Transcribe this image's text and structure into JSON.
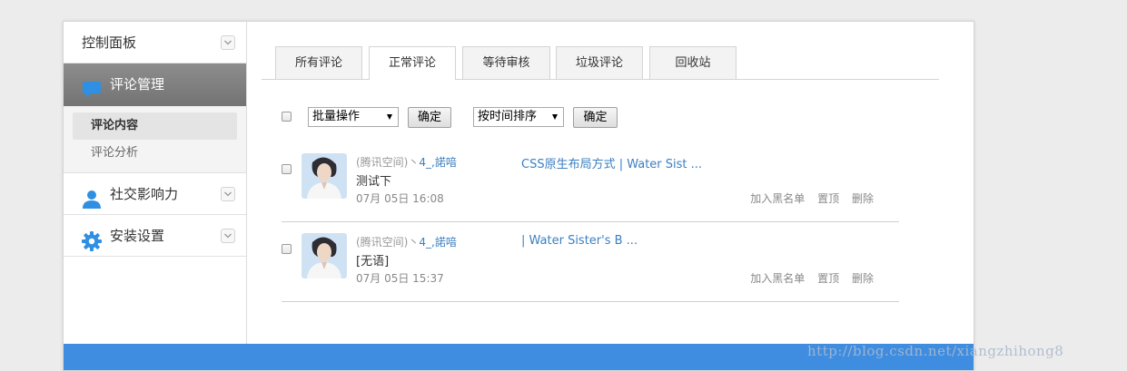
{
  "sidebar": {
    "dashboard": "控制面板",
    "comments_manage": "评论管理",
    "sub": [
      "评论内容",
      "评论分析"
    ],
    "social": "社交影响力",
    "install": "安装设置"
  },
  "tabs": [
    "所有评论",
    "正常评论",
    "等待审核",
    "垃圾评论",
    "回收站"
  ],
  "active_tab": "正常评论",
  "toolbar": {
    "bulk_select": "批量操作",
    "confirm1": "确定",
    "sort_select": "按时间排序",
    "confirm2": "确定"
  },
  "comments": [
    {
      "source": "(腾讯空间)丶",
      "author": "4_,諾喑",
      "post": "CSS原生布局方式 | Water Sist ...",
      "content": "测试下",
      "time": "07月 05日 16:08",
      "actions": [
        "加入黑名单",
        "置顶",
        "删除"
      ]
    },
    {
      "source": "(腾讯空间)丶",
      "author": "4_,諾喑",
      "post": "| Water Sister's B ...",
      "content": "[无语]",
      "time": "07月 05日 15:37",
      "actions": [
        "加入黑名单",
        "置顶",
        "删除"
      ]
    }
  ],
  "watermark": "http://blog.csdn.net/xiangzhihong8",
  "colors": {
    "accent": "#3e8de0",
    "link": "#3a7fc1",
    "active_nav": "#808080"
  }
}
